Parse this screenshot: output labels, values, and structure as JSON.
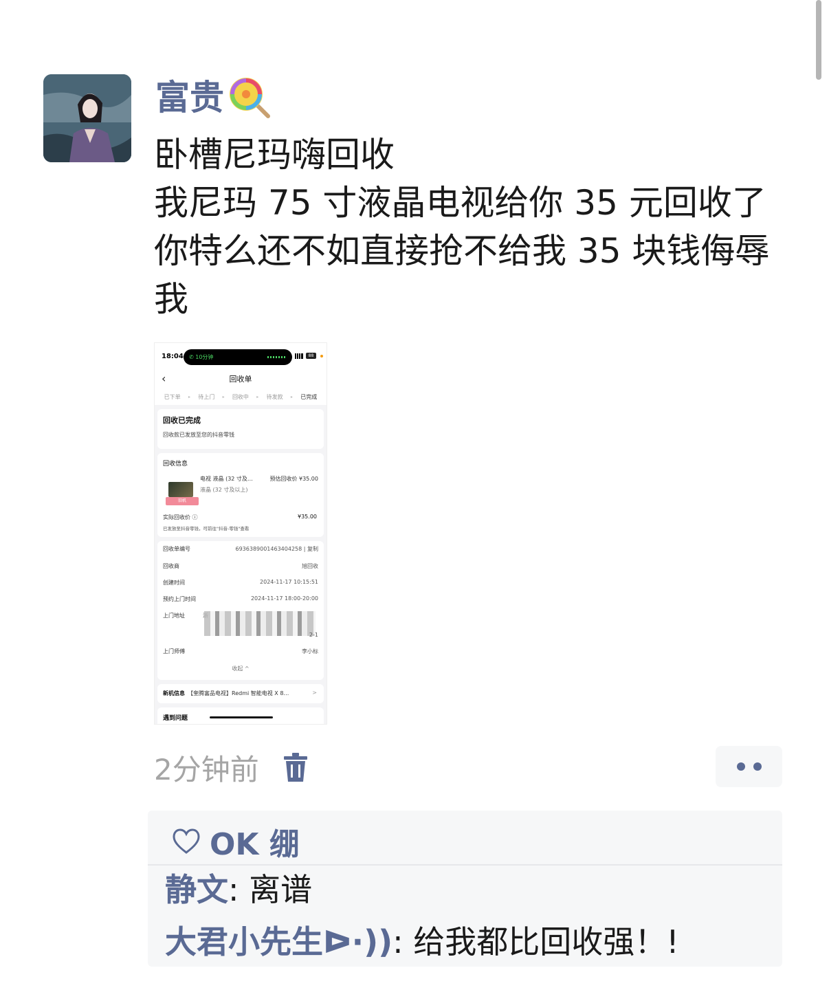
{
  "post": {
    "username": "富贵",
    "text_lines": [
      "卧槽尼玛嗨回收",
      "我尼玛 75 寸液晶电视给你 35 元回收了",
      "你特么还不如直接抢不给我 35 块钱侮辱",
      "我"
    ],
    "time_ago": "2分钟前"
  },
  "screenshot": {
    "status_time": "18:04",
    "call_pill": "10分钟",
    "battery": "88",
    "title": "回收单",
    "steps": [
      "已下单",
      "待上门",
      "回收中",
      "待发款",
      "已完成"
    ],
    "status_title": "回收已完成",
    "status_sub": "回收款已发放至您的抖音零钱",
    "info_title": "回收信息",
    "product": "电视 液晶 (32 寸及…",
    "estimate": "预估回收价 ¥35.00",
    "product_sub": "液晶 (32 寸及以上)",
    "tag": "旧机",
    "actual_label": "实际回收价 ⓘ",
    "actual_value": "¥35.00",
    "note": "已发放至抖音零钱，可前往\"抖音-零钱\"查看",
    "rows": [
      {
        "k": "回收单编号",
        "v": "6936389001463404258 | 复制"
      },
      {
        "k": "回收商",
        "v": "旭回收"
      },
      {
        "k": "创建时间",
        "v": "2024-11-17 10:15:51"
      },
      {
        "k": "预约上门时间",
        "v": "2024-11-17 18:00-20:00"
      },
      {
        "k": "上门地址",
        "v": "浙"
      },
      {
        "k": "",
        "v": "2-1"
      },
      {
        "k": "上门师傅",
        "v": "李小标"
      }
    ],
    "fold": "收起 ^",
    "new_label": "新机信息",
    "new_value": "【奎腾富品电视】Redmi 智能电视 X 8…",
    "new_chevron": ">",
    "problem": "遇到问题"
  },
  "likes": {
    "names": "OK 绷"
  },
  "comments": [
    {
      "who": "静文",
      "sep": ": ",
      "text": "离谱"
    },
    {
      "who": "大君小先生ᐅ·))",
      "sep": ": ",
      "text": "给我都比回收强！!"
    }
  ],
  "colors": {
    "link": "#5a6a94",
    "muted": "#a5a5a5",
    "panel": "#f6f7f8"
  },
  "icons": [
    "lollipop-icon",
    "trash-icon",
    "more-icon",
    "heart-icon"
  ]
}
